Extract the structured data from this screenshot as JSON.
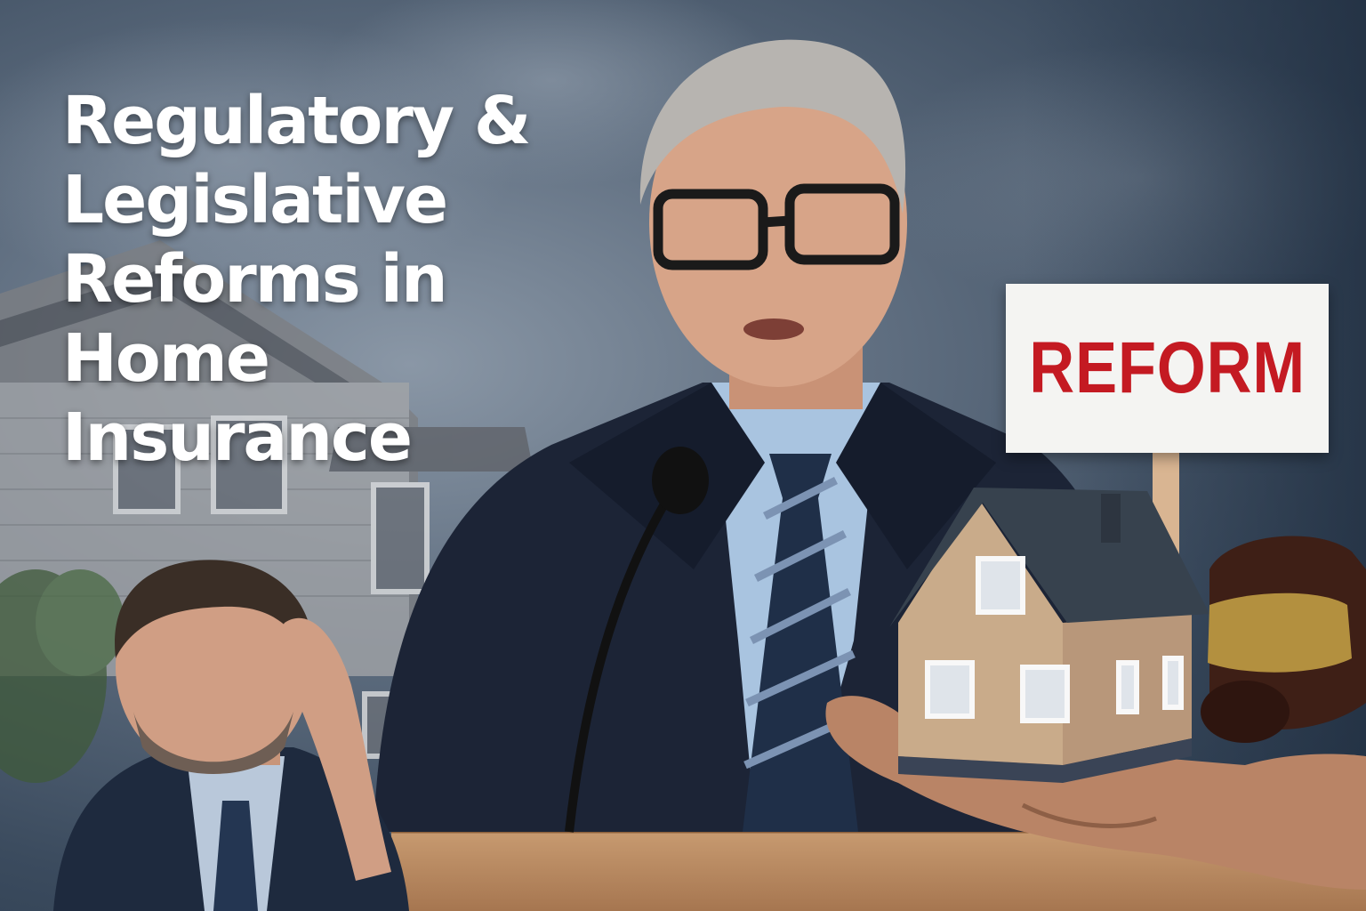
{
  "headline": {
    "lines": [
      "Regulatory &",
      "Legislative",
      "Reforms in",
      "Home",
      "Insurance"
    ]
  },
  "sign": {
    "label": "REFORM"
  },
  "colors": {
    "headline_text": "#ffffff",
    "sign_text": "#c41a22",
    "sign_board": "#f4f4f2",
    "suit": "#1c2436",
    "shirt": "#a9c4e0",
    "model_house": "#c9ab8a"
  }
}
